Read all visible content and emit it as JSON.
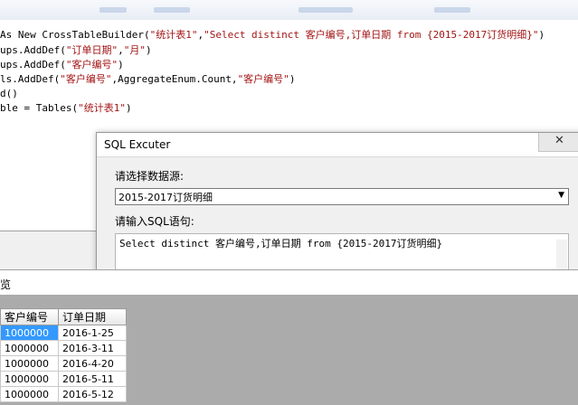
{
  "code_lines": [
    [
      "As New CrossTableBuilder(",
      "\"统计表1\"",
      ",",
      "\"Select distinct 客户编号,订单日期 from {2015-2017订货明细}\"",
      ")"
    ],
    [
      "ups.AddDef(",
      "\"订单日期\"",
      ",",
      "\"月\"",
      ")"
    ],
    [
      "ups.AddDef(",
      "\"客户编号\"",
      ")",
      "",
      ""
    ],
    [
      "ls.AddDef(",
      "\"客户编号\"",
      ",AggregateEnum.Count,",
      "\"客户编号\"",
      ")"
    ],
    [
      "d()",
      "",
      "",
      "",
      ""
    ],
    [
      "ble = Tables(",
      "\"统计表1\"",
      ")",
      "",
      ""
    ]
  ],
  "dialog": {
    "title": "SQL Excuter",
    "close_glyph": "✕",
    "datasource_label": "请选择数据源:",
    "datasource_value": "2015-2017订货明细",
    "sql_label": "请输入SQL语句:",
    "sql_value": "Select distinct 客户编号,订单日期 from {2015-2017订货明细}"
  },
  "preview": {
    "title": "览",
    "columns": [
      "客户编号",
      "订单日期"
    ],
    "rows": [
      [
        "1000000",
        "2016-1-25"
      ],
      [
        "1000000",
        "2016-3-11"
      ],
      [
        "1000000",
        "2016-4-20"
      ],
      [
        "1000000",
        "2016-5-11"
      ],
      [
        "1000000",
        "2016-5-12"
      ]
    ],
    "selected_row": 0
  }
}
